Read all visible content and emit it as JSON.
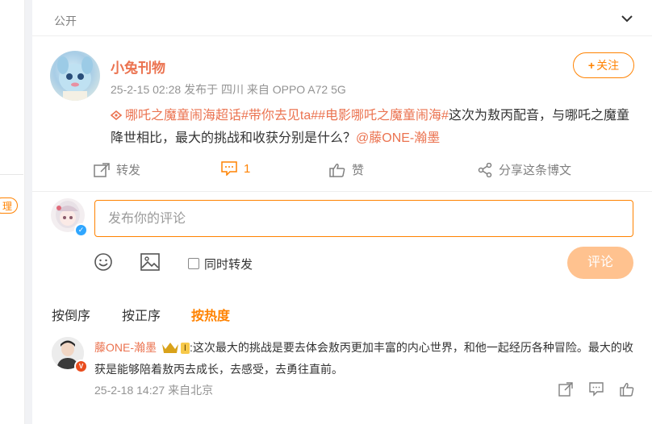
{
  "post": {
    "visibility": "公开",
    "author": "小兔刊物",
    "meta": "25-2-15 02:28  发布于 四川  来自 OPPO A72 5G",
    "follow_label": "关注",
    "text_topics": "哪吒之魔童闹海超话#带你去见ta##电影哪吒之魔童闹海#",
    "text_body": "这次为敖丙配音，与哪吒之魔童降世相比，最大的挑战和收获分别是什么？",
    "text_mention": "@藤ONE-瀚墨",
    "actions": {
      "repost": "转发",
      "comment_count": "1",
      "like": "赞",
      "share": "分享这条博文"
    }
  },
  "left_badge": "理",
  "composer": {
    "placeholder": "发布你的评论",
    "repost_label": "同时转发",
    "submit_label": "评论"
  },
  "sort": {
    "items": [
      "按倒序",
      "按正序",
      "按热度"
    ],
    "active_index": 2
  },
  "comment": {
    "author": "藤ONE-瀚墨",
    "level": "I",
    "text": ":这次最大的挑战是要去体会敖丙更加丰富的内心世界，和他一起经历各种冒险。最大的收获是能够陪着敖丙去成长，去感受，去勇往直前。",
    "meta": "25-2-18 14:27  来自北京"
  },
  "colors": {
    "accent": "#ff8200",
    "link": "#eb7350",
    "submit_disabled": "#ffc28f"
  }
}
